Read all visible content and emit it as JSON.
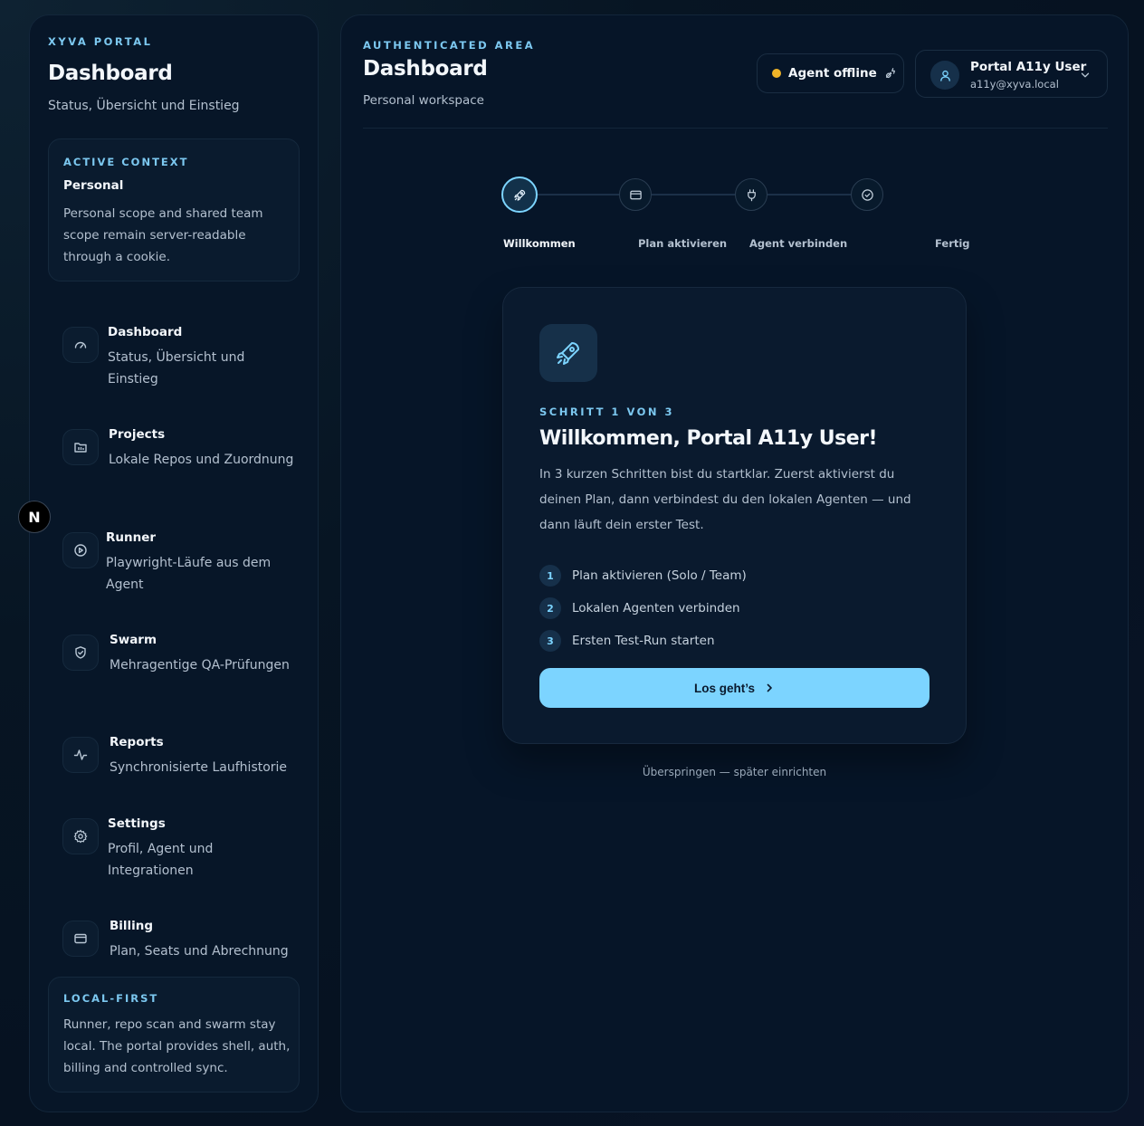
{
  "sidebar": {
    "brand": "XYVA PORTAL",
    "title": "Dashboard",
    "subtitle": "Status, Übersicht und Einstieg",
    "context": {
      "label": "ACTIVE CONTEXT",
      "title": "Personal",
      "description": "Personal scope and shared team scope remain server-readable through a cookie."
    },
    "items": [
      {
        "title": "Dashboard",
        "description": "Status, Übersicht und Einstieg",
        "icon": "gauge-icon"
      },
      {
        "title": "Projects",
        "description": "Lokale Repos und Zuordnung",
        "icon": "folder-icon"
      },
      {
        "title": "Runner",
        "description": "Playwright-Läufe aus dem Agent",
        "icon": "play-icon"
      },
      {
        "title": "Swarm",
        "description": "Mehragentige QA-Prüfungen",
        "icon": "shield-icon"
      },
      {
        "title": "Reports",
        "description": "Synchronisierte Laufhistorie",
        "icon": "activity-icon"
      },
      {
        "title": "Settings",
        "description": "Profil, Agent und Integrationen",
        "icon": "gear-icon"
      },
      {
        "title": "Billing",
        "description": "Plan, Seats und Abrechnung",
        "icon": "credit-card-icon"
      }
    ],
    "local": {
      "label": "LOCAL-FIRST",
      "description": "Runner, repo scan and swarm stay local. The portal provides shell, auth, billing and controlled sync."
    }
  },
  "dev_badge": "N",
  "header": {
    "label": "AUTHENTICATED AREA",
    "title": "Dashboard",
    "subtitle": "Personal workspace",
    "agent_status": "Agent offline",
    "agent_status_color": "#f0b428",
    "user": {
      "name": "Portal A11y User",
      "email": "a11y@xyva.local"
    }
  },
  "stepper": {
    "steps": [
      {
        "label": "Willkommen",
        "icon": "rocket-icon",
        "active": true
      },
      {
        "label": "Plan aktivieren",
        "icon": "credit-card-icon",
        "active": false
      },
      {
        "label": "Agent verbinden",
        "icon": "plug-icon",
        "active": false
      },
      {
        "label": "Fertig",
        "icon": "check-circle-icon",
        "active": false
      }
    ]
  },
  "welcome": {
    "step_of": "SCHRITT 1 VON 3",
    "title": "Willkommen, Portal A11y User!",
    "description": "In 3 kurzen Schritten bist du startklar. Zuerst aktivierst du deinen Plan, dann verbindest du den lokalen Agenten — und dann läuft dein erster Test.",
    "checklist": [
      {
        "num": "1",
        "text": "Plan aktivieren (Solo / Team)"
      },
      {
        "num": "2",
        "text": "Lokalen Agenten verbinden"
      },
      {
        "num": "3",
        "text": "Ersten Test-Run starten"
      }
    ],
    "cta": "Los geht’s",
    "skip": "Überspringen — später einrichten"
  },
  "colors": {
    "accent": "#7cd4ff",
    "label": "#7cc8f0",
    "status_offline": "#f0b428"
  }
}
